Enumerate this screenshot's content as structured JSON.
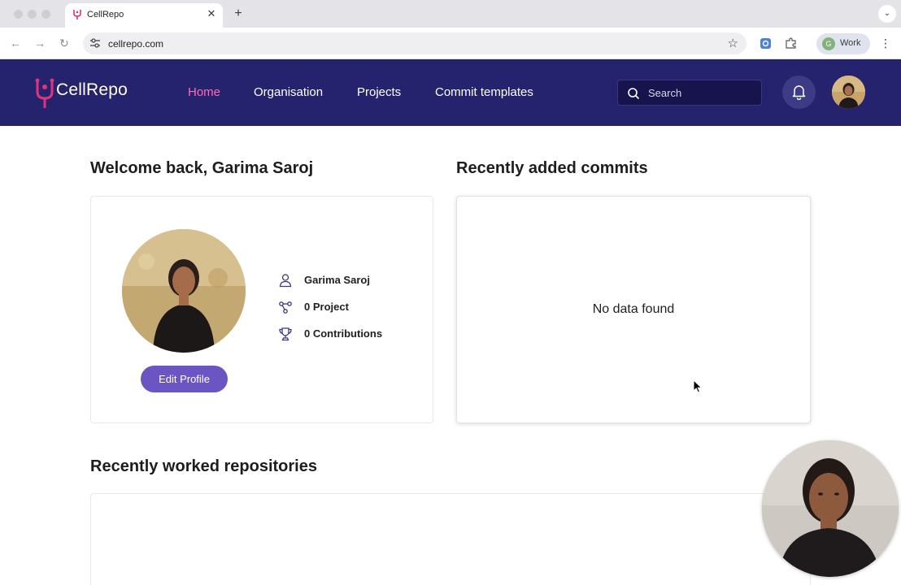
{
  "browser": {
    "tab_title": "CellRepo",
    "url": "cellrepo.com",
    "profile_initial": "G",
    "profile_label": "Work",
    "icons": [
      "back-arrow-icon",
      "forward-arrow-icon",
      "reload-icon",
      "site-settings-icon",
      "bookmark-star-icon",
      "extension-icon",
      "puzzle-icon",
      "kebab-menu-icon"
    ]
  },
  "app": {
    "logo_text": "CellRepo",
    "nav": [
      "Home",
      "Organisation",
      "Projects",
      "Commit templates"
    ],
    "active_nav": "Home",
    "search_placeholder": "Search",
    "colors": {
      "header_bg": "#26236e",
      "active_nav": "#ff6bb5",
      "button": "#6a55c2"
    }
  },
  "welcome": {
    "title": "Welcome back, Garima Saroj",
    "name": "Garima Saroj",
    "projects": "0 Project",
    "contributions": "0 Contributions",
    "edit_button": "Edit Profile"
  },
  "commits": {
    "title": "Recently added commits",
    "empty": "No data found"
  },
  "repositories": {
    "title": "Recently worked repositories"
  }
}
